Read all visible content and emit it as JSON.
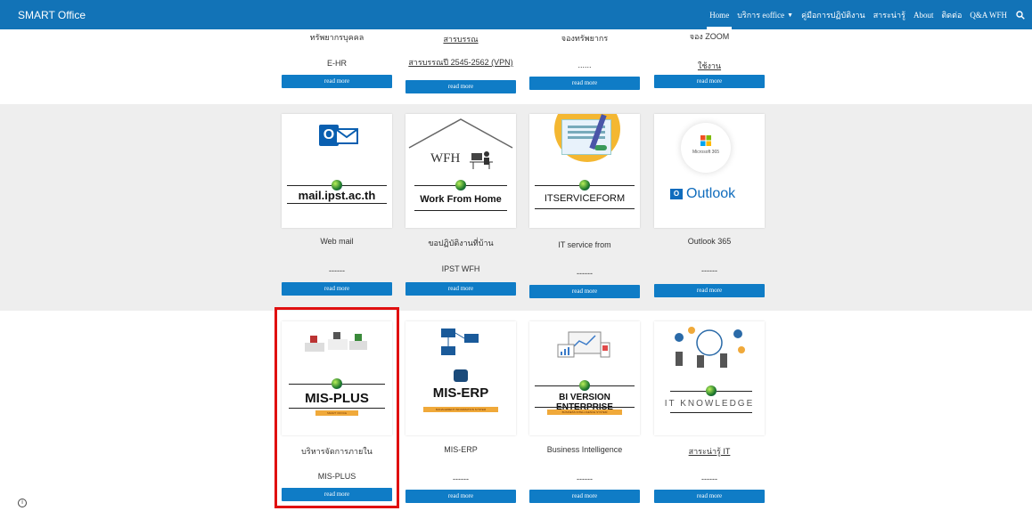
{
  "header": {
    "brand": "SMART Office",
    "nav": [
      {
        "label": "Home",
        "active": true
      },
      {
        "label": "บริการ eoffice",
        "dropdown": true
      },
      {
        "label": "คู่มือการปฏิบัติงาน"
      },
      {
        "label": "สาระน่ารู้"
      },
      {
        "label": "About"
      },
      {
        "label": "ติดต่อ"
      },
      {
        "label": "Q&A WFH"
      }
    ]
  },
  "row1": [
    {
      "top": "ทรัพยากรบุคคล",
      "bottom": "E-HR",
      "button": "read more"
    },
    {
      "top": "สารบรรณ",
      "bottom": "สารบรรณปี 2545-2562 (VPN)",
      "button": "read more"
    },
    {
      "top": "จองทรัพยากร",
      "bottom": "......",
      "button": "read more"
    },
    {
      "top": "จอง ZOOM",
      "bottom": "ใช้งาน",
      "button": "read more"
    }
  ],
  "row2": [
    {
      "card": "mail.ipst.ac.th",
      "caption": "Web mail",
      "sub": "------",
      "button": "read more"
    },
    {
      "card": "Work From Home",
      "card_top": "WFH",
      "caption": "ขอปฏิบัติงานที่บ้าน",
      "sub": "IPST WFH",
      "button": "read more"
    },
    {
      "card": "ITSERVICEFORM",
      "caption": "IT service from",
      "sub": "------",
      "button": "read more"
    },
    {
      "card": "Outlook",
      "card_top": "Microsoft 365",
      "caption": "Outlook 365",
      "sub": "------",
      "button": "read more"
    }
  ],
  "row3": [
    {
      "card": "MIS-PLUS",
      "card_sub": "SMART OFFICE",
      "caption": "บริหารจัดการภายใน",
      "sub": "MIS-PLUS",
      "button": "read more"
    },
    {
      "card": "MIS-ERP",
      "card_sub": "MANAGEMENT INFORMATION SYSTEM",
      "caption": "MIS-ERP",
      "sub": "------",
      "button": "read more"
    },
    {
      "card": "BI VERSION ENTERPRISE",
      "card_sub": "BUSINESS INTELLIGENCE SYSTEM",
      "caption": "Business Intelligence",
      "sub": "------",
      "button": "read more"
    },
    {
      "card": "IT KNOWLEDGE",
      "caption": "สาระน่ารู้ IT",
      "sub": "------",
      "button": "read more"
    }
  ],
  "colors": {
    "nav": "#1273b7",
    "button": "#0f7cc6",
    "highlight": "#e01010",
    "outlook": "#0f6cbd"
  }
}
